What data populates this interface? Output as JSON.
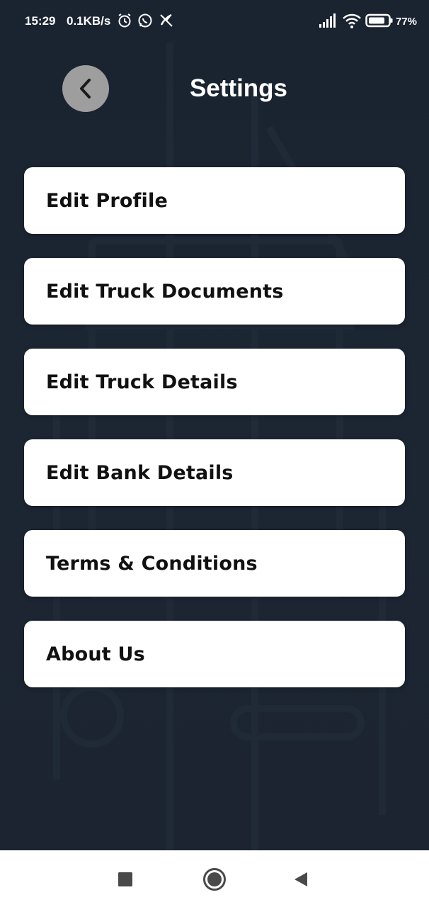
{
  "status_bar": {
    "time": "15:29",
    "speed": "0.1KB/s",
    "battery": "77%",
    "icons": [
      "alarm-icon",
      "whatsapp-icon",
      "missed-call-icon",
      "signal-icon",
      "wifi-icon",
      "battery-icon"
    ]
  },
  "header": {
    "title": "Settings",
    "back_icon": "chevron-left-icon"
  },
  "menu": {
    "items": [
      {
        "label": "Edit Profile"
      },
      {
        "label": "Edit Truck Documents"
      },
      {
        "label": "Edit Truck Details"
      },
      {
        "label": "Edit Bank Details"
      },
      {
        "label": "Terms & Conditions"
      },
      {
        "label": "About Us"
      }
    ]
  },
  "nav_bar": {
    "buttons": [
      "recents-square-icon",
      "home-circle-icon",
      "back-triangle-icon"
    ]
  },
  "colors": {
    "background": "#1c2530",
    "card": "#ffffff",
    "back_button": "#9e9e9e",
    "text_dark": "#111111",
    "text_light": "#ffffff"
  }
}
